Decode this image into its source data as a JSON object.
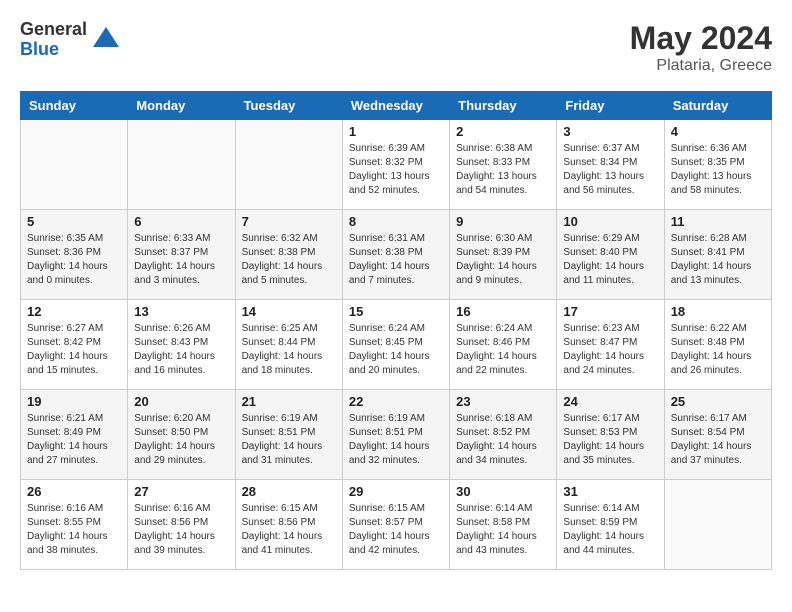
{
  "logo": {
    "general": "General",
    "blue": "Blue"
  },
  "title": "May 2024",
  "location": "Plataria, Greece",
  "days_header": [
    "Sunday",
    "Monday",
    "Tuesday",
    "Wednesday",
    "Thursday",
    "Friday",
    "Saturday"
  ],
  "weeks": [
    [
      {
        "num": "",
        "sunrise": "",
        "sunset": "",
        "daylight": ""
      },
      {
        "num": "",
        "sunrise": "",
        "sunset": "",
        "daylight": ""
      },
      {
        "num": "",
        "sunrise": "",
        "sunset": "",
        "daylight": ""
      },
      {
        "num": "1",
        "sunrise": "Sunrise: 6:39 AM",
        "sunset": "Sunset: 8:32 PM",
        "daylight": "Daylight: 13 hours and 52 minutes."
      },
      {
        "num": "2",
        "sunrise": "Sunrise: 6:38 AM",
        "sunset": "Sunset: 8:33 PM",
        "daylight": "Daylight: 13 hours and 54 minutes."
      },
      {
        "num": "3",
        "sunrise": "Sunrise: 6:37 AM",
        "sunset": "Sunset: 8:34 PM",
        "daylight": "Daylight: 13 hours and 56 minutes."
      },
      {
        "num": "4",
        "sunrise": "Sunrise: 6:36 AM",
        "sunset": "Sunset: 8:35 PM",
        "daylight": "Daylight: 13 hours and 58 minutes."
      }
    ],
    [
      {
        "num": "5",
        "sunrise": "Sunrise: 6:35 AM",
        "sunset": "Sunset: 8:36 PM",
        "daylight": "Daylight: 14 hours and 0 minutes."
      },
      {
        "num": "6",
        "sunrise": "Sunrise: 6:33 AM",
        "sunset": "Sunset: 8:37 PM",
        "daylight": "Daylight: 14 hours and 3 minutes."
      },
      {
        "num": "7",
        "sunrise": "Sunrise: 6:32 AM",
        "sunset": "Sunset: 8:38 PM",
        "daylight": "Daylight: 14 hours and 5 minutes."
      },
      {
        "num": "8",
        "sunrise": "Sunrise: 6:31 AM",
        "sunset": "Sunset: 8:38 PM",
        "daylight": "Daylight: 14 hours and 7 minutes."
      },
      {
        "num": "9",
        "sunrise": "Sunrise: 6:30 AM",
        "sunset": "Sunset: 8:39 PM",
        "daylight": "Daylight: 14 hours and 9 minutes."
      },
      {
        "num": "10",
        "sunrise": "Sunrise: 6:29 AM",
        "sunset": "Sunset: 8:40 PM",
        "daylight": "Daylight: 14 hours and 11 minutes."
      },
      {
        "num": "11",
        "sunrise": "Sunrise: 6:28 AM",
        "sunset": "Sunset: 8:41 PM",
        "daylight": "Daylight: 14 hours and 13 minutes."
      }
    ],
    [
      {
        "num": "12",
        "sunrise": "Sunrise: 6:27 AM",
        "sunset": "Sunset: 8:42 PM",
        "daylight": "Daylight: 14 hours and 15 minutes."
      },
      {
        "num": "13",
        "sunrise": "Sunrise: 6:26 AM",
        "sunset": "Sunset: 8:43 PM",
        "daylight": "Daylight: 14 hours and 16 minutes."
      },
      {
        "num": "14",
        "sunrise": "Sunrise: 6:25 AM",
        "sunset": "Sunset: 8:44 PM",
        "daylight": "Daylight: 14 hours and 18 minutes."
      },
      {
        "num": "15",
        "sunrise": "Sunrise: 6:24 AM",
        "sunset": "Sunset: 8:45 PM",
        "daylight": "Daylight: 14 hours and 20 minutes."
      },
      {
        "num": "16",
        "sunrise": "Sunrise: 6:24 AM",
        "sunset": "Sunset: 8:46 PM",
        "daylight": "Daylight: 14 hours and 22 minutes."
      },
      {
        "num": "17",
        "sunrise": "Sunrise: 6:23 AM",
        "sunset": "Sunset: 8:47 PM",
        "daylight": "Daylight: 14 hours and 24 minutes."
      },
      {
        "num": "18",
        "sunrise": "Sunrise: 6:22 AM",
        "sunset": "Sunset: 8:48 PM",
        "daylight": "Daylight: 14 hours and 26 minutes."
      }
    ],
    [
      {
        "num": "19",
        "sunrise": "Sunrise: 6:21 AM",
        "sunset": "Sunset: 8:49 PM",
        "daylight": "Daylight: 14 hours and 27 minutes."
      },
      {
        "num": "20",
        "sunrise": "Sunrise: 6:20 AM",
        "sunset": "Sunset: 8:50 PM",
        "daylight": "Daylight: 14 hours and 29 minutes."
      },
      {
        "num": "21",
        "sunrise": "Sunrise: 6:19 AM",
        "sunset": "Sunset: 8:51 PM",
        "daylight": "Daylight: 14 hours and 31 minutes."
      },
      {
        "num": "22",
        "sunrise": "Sunrise: 6:19 AM",
        "sunset": "Sunset: 8:51 PM",
        "daylight": "Daylight: 14 hours and 32 minutes."
      },
      {
        "num": "23",
        "sunrise": "Sunrise: 6:18 AM",
        "sunset": "Sunset: 8:52 PM",
        "daylight": "Daylight: 14 hours and 34 minutes."
      },
      {
        "num": "24",
        "sunrise": "Sunrise: 6:17 AM",
        "sunset": "Sunset: 8:53 PM",
        "daylight": "Daylight: 14 hours and 35 minutes."
      },
      {
        "num": "25",
        "sunrise": "Sunrise: 6:17 AM",
        "sunset": "Sunset: 8:54 PM",
        "daylight": "Daylight: 14 hours and 37 minutes."
      }
    ],
    [
      {
        "num": "26",
        "sunrise": "Sunrise: 6:16 AM",
        "sunset": "Sunset: 8:55 PM",
        "daylight": "Daylight: 14 hours and 38 minutes."
      },
      {
        "num": "27",
        "sunrise": "Sunrise: 6:16 AM",
        "sunset": "Sunset: 8:56 PM",
        "daylight": "Daylight: 14 hours and 39 minutes."
      },
      {
        "num": "28",
        "sunrise": "Sunrise: 6:15 AM",
        "sunset": "Sunset: 8:56 PM",
        "daylight": "Daylight: 14 hours and 41 minutes."
      },
      {
        "num": "29",
        "sunrise": "Sunrise: 6:15 AM",
        "sunset": "Sunset: 8:57 PM",
        "daylight": "Daylight: 14 hours and 42 minutes."
      },
      {
        "num": "30",
        "sunrise": "Sunrise: 6:14 AM",
        "sunset": "Sunset: 8:58 PM",
        "daylight": "Daylight: 14 hours and 43 minutes."
      },
      {
        "num": "31",
        "sunrise": "Sunrise: 6:14 AM",
        "sunset": "Sunset: 8:59 PM",
        "daylight": "Daylight: 14 hours and 44 minutes."
      },
      {
        "num": "",
        "sunrise": "",
        "sunset": "",
        "daylight": ""
      }
    ]
  ]
}
